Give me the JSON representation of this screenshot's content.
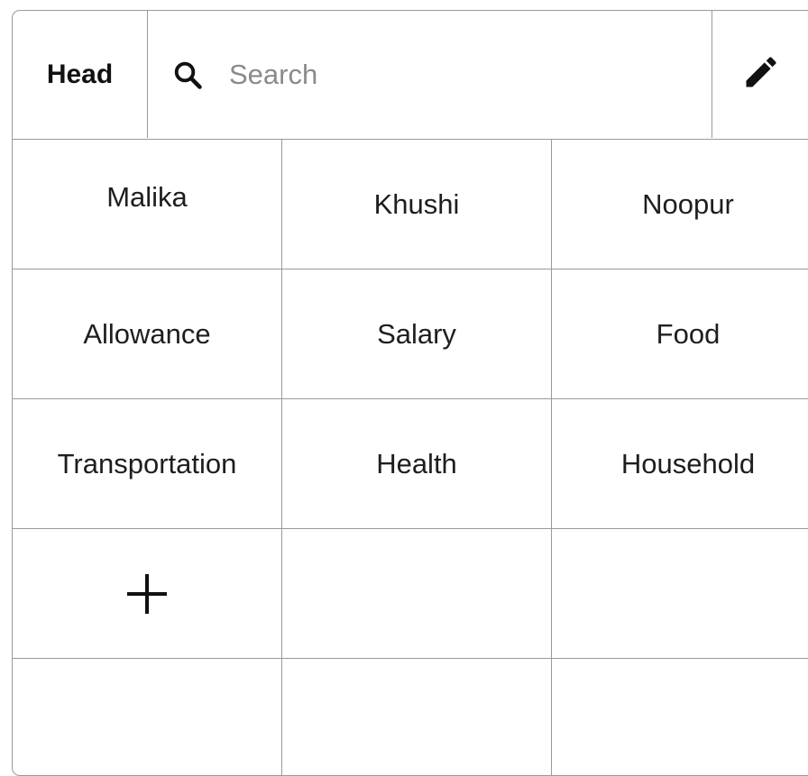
{
  "header": {
    "head_label": "Head",
    "search": {
      "placeholder": "Search",
      "value": ""
    },
    "edit_icon": "pencil-icon"
  },
  "grid": {
    "names": [
      "Malika",
      "Khushi",
      "Noopur"
    ],
    "categories_row1": [
      "Allowance",
      "Salary",
      "Food"
    ],
    "categories_row2": [
      "Transportation",
      "Health",
      "Household"
    ],
    "add_icon": "plus-icon"
  }
}
